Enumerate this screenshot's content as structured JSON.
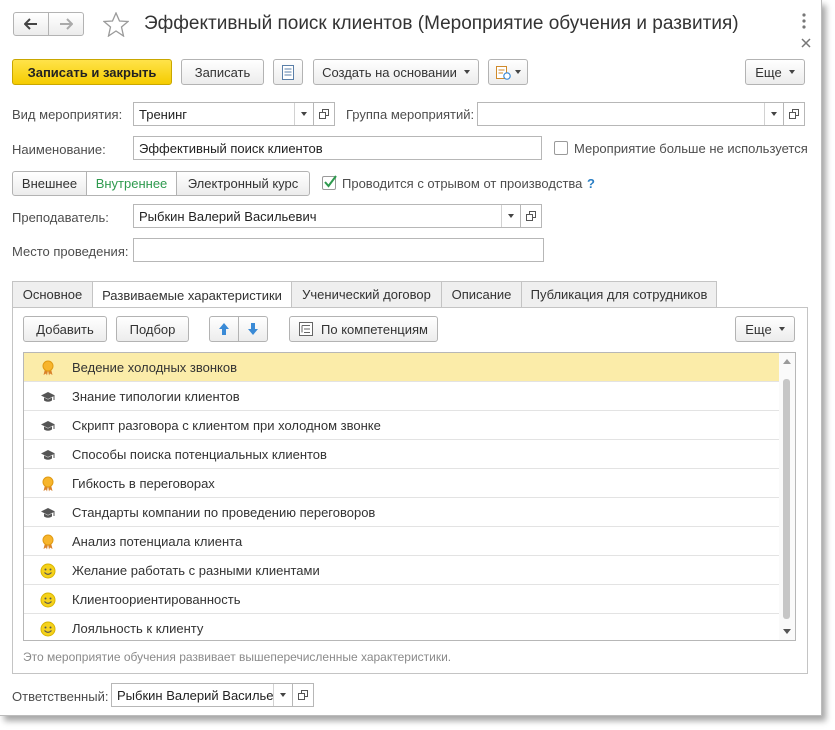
{
  "window": {
    "title": "Эффективный поиск клиентов (Мероприятие обучения и развития)"
  },
  "toolbar": {
    "save_close": "Записать и закрыть",
    "save": "Записать",
    "create_based": "Создать на основании",
    "more": "Еще"
  },
  "form": {
    "event_type_label": "Вид мероприятия:",
    "event_type_value": "Тренинг",
    "event_group_label": "Группа мероприятий:",
    "event_group_value": "",
    "name_label": "Наименование:",
    "name_value": "Эффективный поиск клиентов",
    "not_used_label": "Мероприятие больше не используется",
    "mode_options": [
      "Внешнее",
      "Внутреннее",
      "Электронный курс"
    ],
    "mode_selected": "Внутреннее",
    "off_job_label": "Проводится с отрывом от производства",
    "help_mark": "?",
    "teacher_label": "Преподаватель:",
    "teacher_value": "Рыбкин Валерий Васильевич",
    "place_label": "Место проведения:",
    "place_value": ""
  },
  "tabs": [
    {
      "label": "Основное"
    },
    {
      "label": "Развиваемые характеристики"
    },
    {
      "label": "Ученический договор"
    },
    {
      "label": "Описание"
    },
    {
      "label": "Публикация для сотрудников"
    }
  ],
  "list_toolbar": {
    "add": "Добавить",
    "pick": "Подбор",
    "by_competencies": "По компетенциям",
    "more": "Еще"
  },
  "characteristics": [
    {
      "icon": "medal-icon",
      "label": "Ведение холодных звонков"
    },
    {
      "icon": "graduation-cap-icon",
      "label": "Знание типологии клиентов"
    },
    {
      "icon": "graduation-cap-icon",
      "label": "Скрипт разговора с клиентом при холодном звонке"
    },
    {
      "icon": "graduation-cap-icon",
      "label": "Способы поиска потенциальных клиентов"
    },
    {
      "icon": "medal-icon",
      "label": "Гибкость в переговорах"
    },
    {
      "icon": "graduation-cap-icon",
      "label": "Стандарты компании по проведению переговоров"
    },
    {
      "icon": "medal-icon",
      "label": "Анализ потенциала клиента"
    },
    {
      "icon": "smiley-icon",
      "label": "Желание работать с разными клиентами"
    },
    {
      "icon": "smiley-icon",
      "label": "Клиентоориентированность"
    },
    {
      "icon": "smiley-icon",
      "label": "Лояльность к клиенту"
    }
  ],
  "hint": "Это мероприятие обучения развивает вышеперечисленные характеристики.",
  "footer": {
    "responsible_label": "Ответственный:",
    "responsible_value": "Рыбкин Валерий Василье"
  },
  "colors": {
    "primary": "#f5cc00",
    "selected_row": "#fbeca9",
    "active_segment": "#2e9a4e",
    "help": "#2b7fc4",
    "arrows": "#3a8ad6"
  }
}
